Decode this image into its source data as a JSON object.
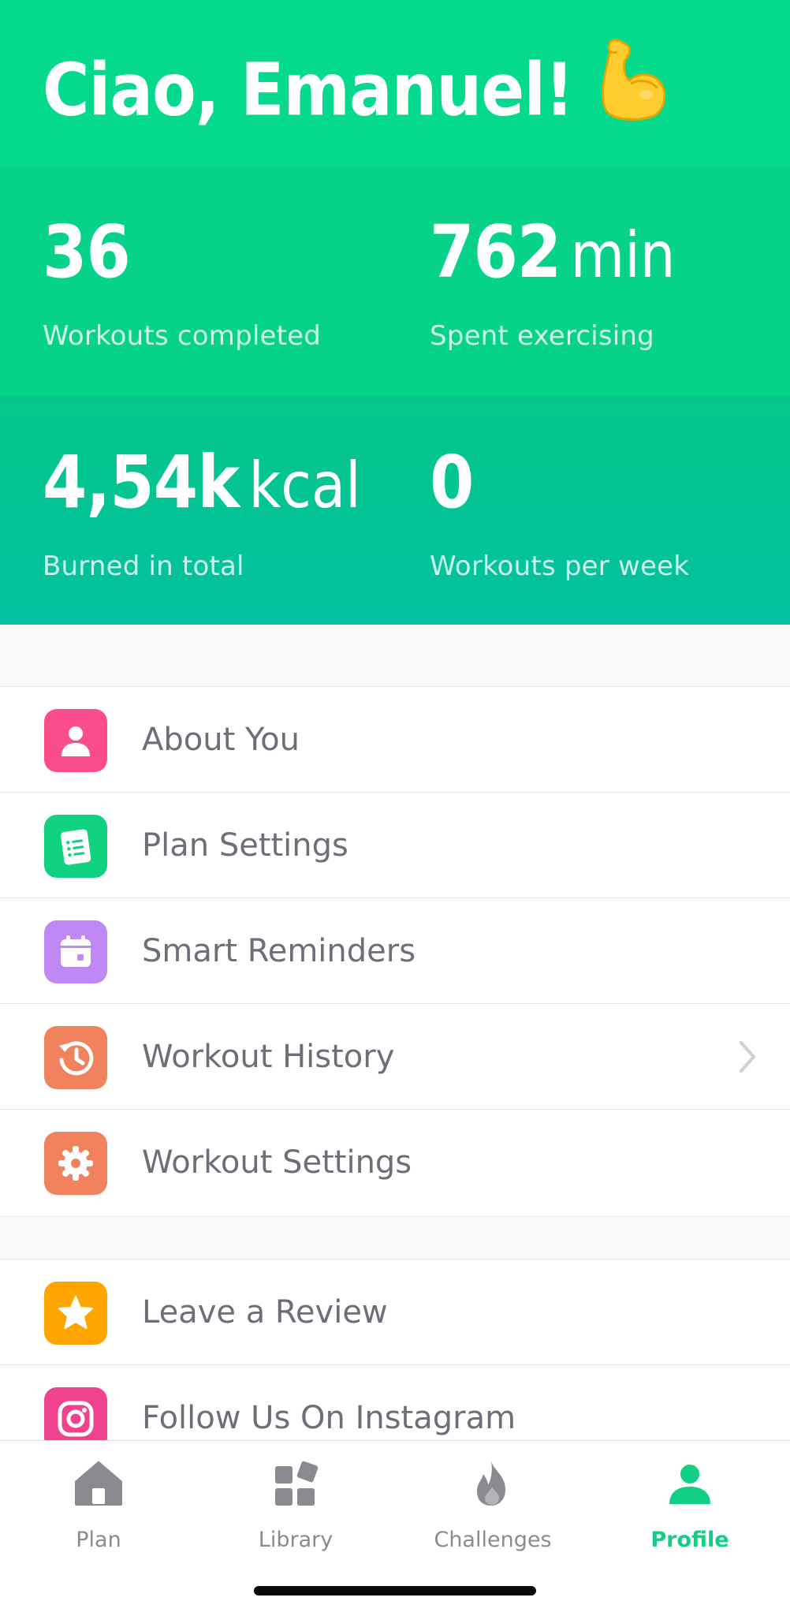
{
  "header": {
    "greeting": "Ciao, Emanuel!",
    "emoji": "flexed-biceps",
    "background_color": "#05d98c"
  },
  "stats": [
    {
      "value": "36",
      "unit": "",
      "label": "Workouts completed"
    },
    {
      "value": "762",
      "unit": "min",
      "label": "Spent exercising"
    },
    {
      "value": "4,54k",
      "unit": "kcal",
      "label": "Burned in total"
    },
    {
      "value": "0",
      "unit": "",
      "label": "Workouts per week"
    }
  ],
  "menu": {
    "section1": [
      {
        "label": "About You",
        "icon": "person-icon",
        "color": "#fb4d8b"
      },
      {
        "label": "Plan Settings",
        "icon": "plan-list-icon",
        "color": "#10d27f"
      },
      {
        "label": "Smart Reminders",
        "icon": "calendar-icon",
        "color": "#bf88f4"
      },
      {
        "label": "Workout History",
        "icon": "history-icon",
        "color": "#f0825e"
      },
      {
        "label": "Workout Settings",
        "icon": "gear-icon",
        "color": "#f0825e"
      }
    ],
    "section2": [
      {
        "label": "Leave a Review",
        "icon": "star-icon",
        "color": "#ffa500"
      },
      {
        "label": "Follow Us On Instagram",
        "icon": "instagram-icon",
        "color": "#f0428e"
      }
    ]
  },
  "tabbar": {
    "tabs": [
      {
        "label": "Plan",
        "icon": "home-icon"
      },
      {
        "label": "Library",
        "icon": "library-icon"
      },
      {
        "label": "Challenges",
        "icon": "flame-icon"
      },
      {
        "label": "Profile",
        "icon": "person-icon"
      }
    ],
    "active": "Profile",
    "active_color": "#13cf86",
    "inactive_color": "#8a8a90"
  }
}
